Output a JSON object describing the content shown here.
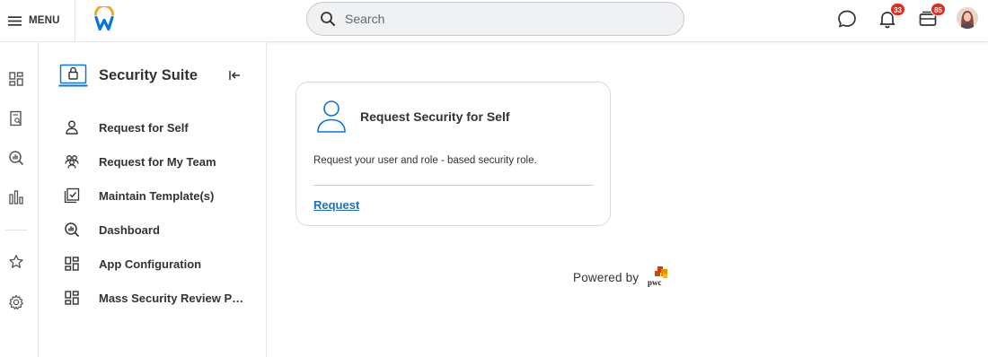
{
  "topbar": {
    "menu_label": "MENU",
    "search": {
      "placeholder": "Search"
    },
    "notifications_count": "33",
    "inbox_count": "85"
  },
  "sidebar": {
    "title": "Security Suite",
    "items": [
      {
        "label": "Request for Self",
        "icon": "person-icon"
      },
      {
        "label": "Request for My Team",
        "icon": "team-icon"
      },
      {
        "label": "Maintain Template(s)",
        "icon": "checkbox-template-icon"
      },
      {
        "label": "Dashboard",
        "icon": "dashboard-search-icon"
      },
      {
        "label": "App Configuration",
        "icon": "grid-icon"
      },
      {
        "label": "Mass Security Review Pro...",
        "icon": "grid-icon"
      }
    ]
  },
  "card": {
    "title": "Request Security for Self",
    "description": "Request your user and role - based security role.",
    "link_label": "Request"
  },
  "footer": {
    "powered_by": "Powered by",
    "logo_text": "pwc"
  },
  "colors": {
    "accent_link": "#1f6cc5",
    "badge_red": "#de2e21",
    "logo_blue": "#0875e1",
    "logo_orange": "#f5a623"
  }
}
